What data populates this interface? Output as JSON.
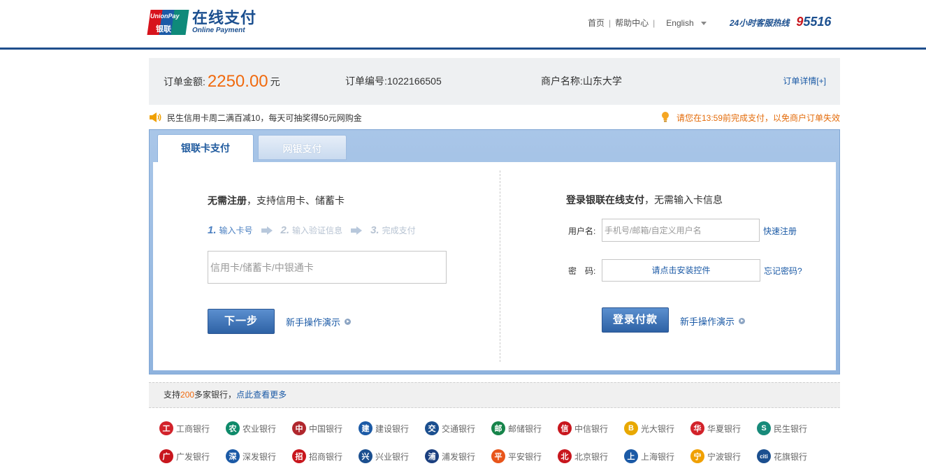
{
  "header": {
    "logo_mark_text": "UnionPay",
    "logo_mark_cn": "银联",
    "logo_cn": "在线支付",
    "logo_en": "Online Payment",
    "nav_home": "首页",
    "nav_help": "帮助中心",
    "nav_lang": "English",
    "hotline_label": "24小时客服热线",
    "hotline_number_a": "9",
    "hotline_number_b": "5516"
  },
  "order": {
    "amount_label": "订单金额:",
    "amount": "2250.00",
    "currency": "元",
    "number_label": "订单编号:",
    "number": "1022166505",
    "merchant_label": "商户名称:",
    "merchant": "山东大学",
    "detail_link": "订单详情[+]"
  },
  "notice": {
    "promo": "民生信用卡周二满百减10，每天可抽奖得50元网购金",
    "timeout": "请您在13:59前完成支付，以免商户订单失效"
  },
  "tabs": {
    "card_pay": "银联卡支付",
    "bank_pay": "网银支付"
  },
  "left": {
    "title_bold": "无需注册",
    "title_rest": "，支持信用卡、储蓄卡",
    "step1_num": "1.",
    "step1": "输入卡号",
    "step2_num": "2.",
    "step2": "输入验证信息",
    "step3_num": "3.",
    "step3": "完成支付",
    "card_placeholder": "信用卡/储蓄卡/中银通卡",
    "next_button": "下一步",
    "demo_link": "新手操作演示"
  },
  "right": {
    "title_bold": "登录银联在线支付",
    "title_rest": "，无需输入卡信息",
    "user_label": "用户名:",
    "user_placeholder": "手机号/邮箱/自定义用户名",
    "register_link": "快速注册",
    "pass_label": "密　码:",
    "pass_install": "请点击安装控件",
    "forgot_link": "忘记密码?",
    "login_button": "登录付款",
    "demo_link": "新手操作演示"
  },
  "bankbar": {
    "prefix": "支持",
    "count": "200",
    "suffix": "多家银行，",
    "more_link": "点此查看更多"
  },
  "banks": [
    {
      "name": "工商银行",
      "icon": "icbc-icon",
      "color": "#d2222a",
      "glyph": "工"
    },
    {
      "name": "农业银行",
      "icon": "abc-icon",
      "color": "#0e8a6a",
      "glyph": "农"
    },
    {
      "name": "中国银行",
      "icon": "boc-icon",
      "color": "#b0272d",
      "glyph": "中"
    },
    {
      "name": "建设银行",
      "icon": "ccb-icon",
      "color": "#1b5aa6",
      "glyph": "建"
    },
    {
      "name": "交通银行",
      "icon": "bocom-icon",
      "color": "#1b4f8f",
      "glyph": "交"
    },
    {
      "name": "邮储银行",
      "icon": "psbc-icon",
      "color": "#16844a",
      "glyph": "邮"
    },
    {
      "name": "中信银行",
      "icon": "citic-icon",
      "color": "#c8161d",
      "glyph": "信"
    },
    {
      "name": "光大银行",
      "icon": "ceb-icon",
      "color": "#e8a800",
      "glyph": "B"
    },
    {
      "name": "华夏银行",
      "icon": "hxb-icon",
      "color": "#d2222a",
      "glyph": "华"
    },
    {
      "name": "民生银行",
      "icon": "cmbc-icon",
      "color": "#178a7a",
      "glyph": "S"
    },
    {
      "name": "广发银行",
      "icon": "cgb-icon",
      "color": "#c8161d",
      "glyph": "广"
    },
    {
      "name": "深发银行",
      "icon": "sdb-icon",
      "color": "#1b5aa6",
      "glyph": "深"
    },
    {
      "name": "招商银行",
      "icon": "cmb-icon",
      "color": "#c8161d",
      "glyph": "招"
    },
    {
      "name": "兴业银行",
      "icon": "cib-icon",
      "color": "#1b4f8f",
      "glyph": "兴"
    },
    {
      "name": "浦发银行",
      "icon": "spdb-icon",
      "color": "#1b3f7f",
      "glyph": "浦"
    },
    {
      "name": "平安银行",
      "icon": "pingan-icon",
      "color": "#e8551a",
      "glyph": "平"
    },
    {
      "name": "北京银行",
      "icon": "bob-icon",
      "color": "#c8161d",
      "glyph": "北"
    },
    {
      "name": "上海银行",
      "icon": "bosc-icon",
      "color": "#1b5aa6",
      "glyph": "上"
    },
    {
      "name": "宁波银行",
      "icon": "nbcb-icon",
      "color": "#f0a000",
      "glyph": "宁"
    },
    {
      "name": "花旗银行",
      "icon": "citi-icon",
      "color": "#1b4f8f",
      "glyph": "citi"
    }
  ]
}
